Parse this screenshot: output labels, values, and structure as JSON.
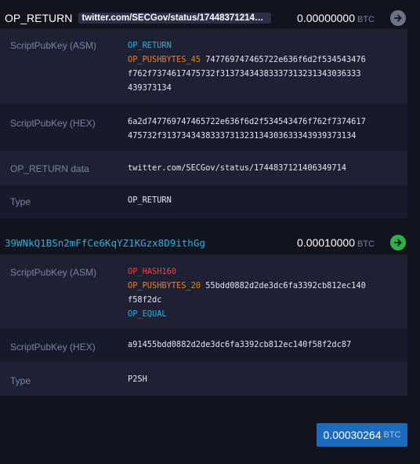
{
  "output1": {
    "label": "OP_RETURN",
    "chip_text": "twitter.com/SECGov/status/17448371214063...",
    "amount": "0.00000000",
    "unit": "BTC",
    "arrow_icon": "arrow-right-icon",
    "asm_label": "ScriptPubKey (ASM)",
    "asm": {
      "op1": "OP_RETURN",
      "op2": "OP_PUSHBYTES_45",
      "data_line1": "747769747465722e636f6d2f534543476",
      "data_line2": "f762f7374617475732f31373434383337313231343036333",
      "data_line3": "439373134"
    },
    "hex_label": "ScriptPubKey (HEX)",
    "hex_line1": "6a2d747769747465722e636f6d2f534543476f762f7374617",
    "hex_line2": "475732f3137343438333731323134303633343939373134",
    "opreturn_label": "OP_RETURN data",
    "opreturn_value": "twitter.com/SECGov/status/1744837121406349714",
    "type_label": "Type",
    "type_value": "OP_RETURN"
  },
  "output2": {
    "address": "39WNkQ1BSn2mFfCe6KqYZ1KGzx8D9ithGg",
    "amount": "0.00010000",
    "unit": "BTC",
    "arrow_icon": "arrow-right-icon",
    "asm_label": "ScriptPubKey (ASM)",
    "asm": {
      "op1": "OP_HASH160",
      "op2": "OP_PUSHBYTES_20",
      "data_line1": "55bdd0882d2de3dc6fa3392cb812ec140",
      "data_line2": "f58f2dc",
      "op3": "OP_EQUAL"
    },
    "hex_label": "ScriptPubKey (HEX)",
    "hex_value": "a91455bdd0882d2de3dc6fa3392cb812ec140f58f2dc87",
    "type_label": "Type",
    "type_value": "P2SH"
  },
  "total": {
    "amount": "0.00030264",
    "unit": "BTC"
  },
  "colors": {
    "background": "#11131f",
    "row_dark": "#1e2133",
    "row_light": "#171a2b",
    "label": "#7c82a3",
    "op_blue": "#2bb1d8",
    "op_orange": "#e8821c",
    "op_red": "#e8453c",
    "spent_arrow": "#6e7285",
    "unspent_arrow": "#2db24b",
    "total_button": "#1c6bbf"
  }
}
